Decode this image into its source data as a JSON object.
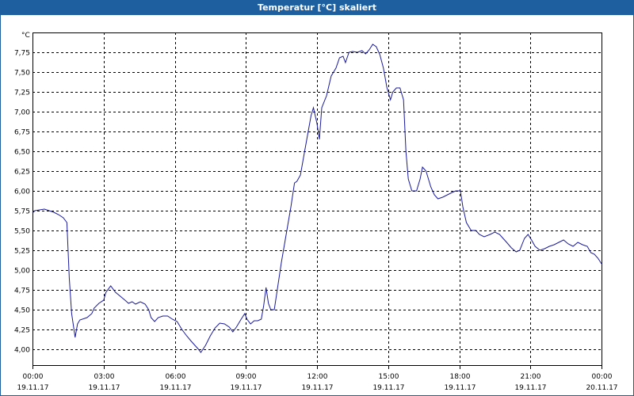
{
  "window": {
    "title": "Temperatur [°C] skaliert"
  },
  "colors": {
    "titlebar": "#1e5fa0",
    "line": "#1a1a9c",
    "grid": "#000000"
  },
  "chart_data": {
    "type": "line",
    "title": "Temperatur [°C] skaliert",
    "ylabel": "°C",
    "ylim": [
      3.8,
      8.0
    ],
    "xlim_hours": [
      0,
      24
    ],
    "y_ticks": [
      4.0,
      4.25,
      4.5,
      4.75,
      5.0,
      5.25,
      5.5,
      5.75,
      6.0,
      6.25,
      6.5,
      6.75,
      7.0,
      7.25,
      7.5,
      7.75
    ],
    "y_tick_labels": [
      "4,00",
      "4,25",
      "4,50",
      "4,75",
      "5,00",
      "5,25",
      "5,50",
      "5,75",
      "6,00",
      "6,25",
      "6,50",
      "6,75",
      "7,00",
      "7,25",
      "7,50",
      "7,75"
    ],
    "x_ticks": [
      {
        "hour": 0,
        "time": "00:00",
        "date": "19.11.17"
      },
      {
        "hour": 3,
        "time": "03:00",
        "date": "19.11.17"
      },
      {
        "hour": 6,
        "time": "06:00",
        "date": "19.11.17"
      },
      {
        "hour": 9,
        "time": "09:00",
        "date": "19.11.17"
      },
      {
        "hour": 12,
        "time": "12:00",
        "date": "19.11.17"
      },
      {
        "hour": 15,
        "time": "15:00",
        "date": "19.11.17"
      },
      {
        "hour": 18,
        "time": "18:00",
        "date": "19.11.17"
      },
      {
        "hour": 21,
        "time": "21:00",
        "date": "19.11.17"
      },
      {
        "hour": 24,
        "time": "00:00",
        "date": "20.11.17"
      }
    ],
    "grid": true,
    "series": [
      {
        "points": [
          [
            0.0,
            5.72
          ],
          [
            0.1,
            5.75
          ],
          [
            0.3,
            5.76
          ],
          [
            0.5,
            5.77
          ],
          [
            0.7,
            5.75
          ],
          [
            0.9,
            5.73
          ],
          [
            1.1,
            5.7
          ],
          [
            1.3,
            5.66
          ],
          [
            1.45,
            5.6
          ],
          [
            1.55,
            4.9
          ],
          [
            1.65,
            4.45
          ],
          [
            1.8,
            4.15
          ],
          [
            1.9,
            4.32
          ],
          [
            2.0,
            4.37
          ],
          [
            2.3,
            4.4
          ],
          [
            2.5,
            4.45
          ],
          [
            2.6,
            4.52
          ],
          [
            2.8,
            4.58
          ],
          [
            3.0,
            4.62
          ],
          [
            3.1,
            4.72
          ],
          [
            3.3,
            4.8
          ],
          [
            3.5,
            4.72
          ],
          [
            3.7,
            4.67
          ],
          [
            3.9,
            4.62
          ],
          [
            4.05,
            4.58
          ],
          [
            4.2,
            4.6
          ],
          [
            4.35,
            4.57
          ],
          [
            4.55,
            4.6
          ],
          [
            4.75,
            4.57
          ],
          [
            4.9,
            4.5
          ],
          [
            5.0,
            4.4
          ],
          [
            5.15,
            4.35
          ],
          [
            5.3,
            4.4
          ],
          [
            5.5,
            4.42
          ],
          [
            5.7,
            4.42
          ],
          [
            5.9,
            4.38
          ],
          [
            6.1,
            4.35
          ],
          [
            6.3,
            4.25
          ],
          [
            6.5,
            4.17
          ],
          [
            6.7,
            4.1
          ],
          [
            6.85,
            4.05
          ],
          [
            7.0,
            4.0
          ],
          [
            7.1,
            3.96
          ],
          [
            7.3,
            4.05
          ],
          [
            7.5,
            4.17
          ],
          [
            7.7,
            4.27
          ],
          [
            7.9,
            4.33
          ],
          [
            8.1,
            4.32
          ],
          [
            8.3,
            4.28
          ],
          [
            8.45,
            4.22
          ],
          [
            8.6,
            4.28
          ],
          [
            8.8,
            4.38
          ],
          [
            8.95,
            4.45
          ],
          [
            9.05,
            4.38
          ],
          [
            9.2,
            4.32
          ],
          [
            9.35,
            4.36
          ],
          [
            9.5,
            4.36
          ],
          [
            9.65,
            4.38
          ],
          [
            9.75,
            4.55
          ],
          [
            9.85,
            4.78
          ],
          [
            9.9,
            4.68
          ],
          [
            9.95,
            4.58
          ],
          [
            10.05,
            4.5
          ],
          [
            10.2,
            4.5
          ],
          [
            10.35,
            4.8
          ],
          [
            10.5,
            5.1
          ],
          [
            10.7,
            5.45
          ],
          [
            10.9,
            5.8
          ],
          [
            11.05,
            6.1
          ],
          [
            11.15,
            6.12
          ],
          [
            11.3,
            6.2
          ],
          [
            11.45,
            6.45
          ],
          [
            11.6,
            6.7
          ],
          [
            11.75,
            6.95
          ],
          [
            11.85,
            7.05
          ],
          [
            12.0,
            6.85
          ],
          [
            12.1,
            6.65
          ],
          [
            12.2,
            7.05
          ],
          [
            12.4,
            7.2
          ],
          [
            12.6,
            7.45
          ],
          [
            12.8,
            7.55
          ],
          [
            12.95,
            7.68
          ],
          [
            13.1,
            7.7
          ],
          [
            13.2,
            7.62
          ],
          [
            13.35,
            7.75
          ],
          [
            13.5,
            7.76
          ],
          [
            13.7,
            7.75
          ],
          [
            13.9,
            7.77
          ],
          [
            14.05,
            7.73
          ],
          [
            14.2,
            7.78
          ],
          [
            14.35,
            7.85
          ],
          [
            14.5,
            7.82
          ],
          [
            14.65,
            7.72
          ],
          [
            14.8,
            7.55
          ],
          [
            14.95,
            7.3
          ],
          [
            15.1,
            7.15
          ],
          [
            15.2,
            7.25
          ],
          [
            15.35,
            7.3
          ],
          [
            15.5,
            7.3
          ],
          [
            15.65,
            7.15
          ],
          [
            15.75,
            6.5
          ],
          [
            15.85,
            6.15
          ],
          [
            16.0,
            6.0
          ],
          [
            16.2,
            6.0
          ],
          [
            16.35,
            6.15
          ],
          [
            16.45,
            6.3
          ],
          [
            16.6,
            6.25
          ],
          [
            16.8,
            6.05
          ],
          [
            16.95,
            5.95
          ],
          [
            17.1,
            5.9
          ],
          [
            17.3,
            5.92
          ],
          [
            17.5,
            5.95
          ],
          [
            17.7,
            5.98
          ],
          [
            17.85,
            6.0
          ],
          [
            18.05,
            6.0
          ],
          [
            18.15,
            5.8
          ],
          [
            18.3,
            5.6
          ],
          [
            18.5,
            5.5
          ],
          [
            18.7,
            5.5
          ],
          [
            18.85,
            5.45
          ],
          [
            19.05,
            5.42
          ],
          [
            19.3,
            5.45
          ],
          [
            19.5,
            5.48
          ],
          [
            19.7,
            5.45
          ],
          [
            19.85,
            5.4
          ],
          [
            20.0,
            5.35
          ],
          [
            20.2,
            5.28
          ],
          [
            20.4,
            5.23
          ],
          [
            20.55,
            5.25
          ],
          [
            20.75,
            5.4
          ],
          [
            20.9,
            5.45
          ],
          [
            21.05,
            5.38
          ],
          [
            21.2,
            5.3
          ],
          [
            21.4,
            5.25
          ],
          [
            21.6,
            5.27
          ],
          [
            21.8,
            5.3
          ],
          [
            22.0,
            5.32
          ],
          [
            22.2,
            5.35
          ],
          [
            22.4,
            5.38
          ],
          [
            22.6,
            5.33
          ],
          [
            22.8,
            5.3
          ],
          [
            23.0,
            5.35
          ],
          [
            23.2,
            5.32
          ],
          [
            23.4,
            5.3
          ],
          [
            23.55,
            5.22
          ],
          [
            23.7,
            5.2
          ],
          [
            23.85,
            5.15
          ],
          [
            24.0,
            5.08
          ]
        ]
      }
    ]
  }
}
